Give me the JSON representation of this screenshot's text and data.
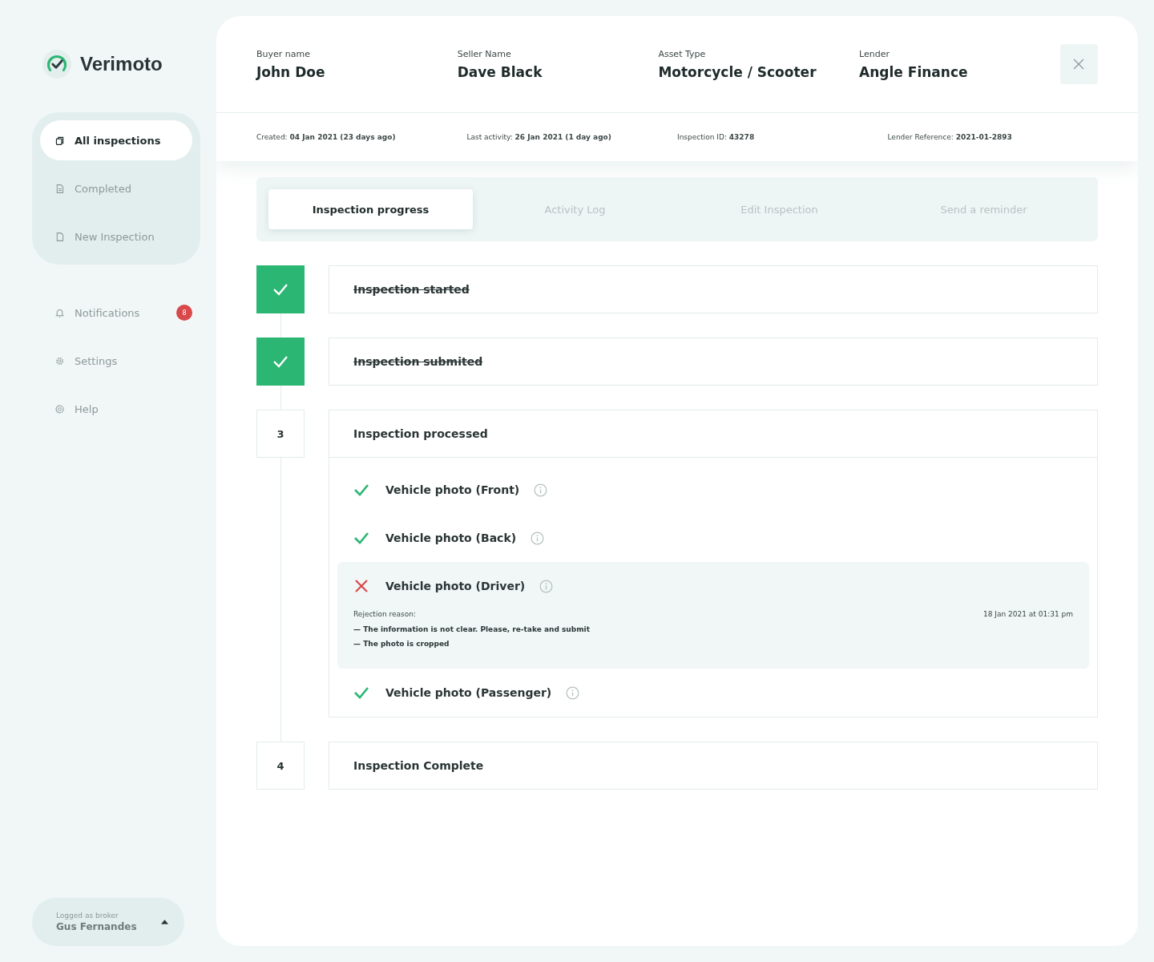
{
  "brand": {
    "name": "Verimoto"
  },
  "nav_primary": [
    {
      "label": "All inspections",
      "selected": true
    },
    {
      "label": "Completed",
      "selected": false
    },
    {
      "label": "New Inspection",
      "selected": false
    }
  ],
  "nav_secondary": [
    {
      "label": "Notifications",
      "badge": "8"
    },
    {
      "label": "Settings"
    },
    {
      "label": "Help"
    }
  ],
  "user": {
    "caption": "Logged as broker",
    "name": "Gus Fernandes"
  },
  "header": {
    "fields": [
      {
        "label": "Buyer name",
        "value": "John Doe"
      },
      {
        "label": "Seller Name",
        "value": "Dave Black"
      },
      {
        "label": "Asset Type",
        "value": "Motorcycle / Scooter"
      },
      {
        "label": "Lender",
        "value": "Angle Finance"
      }
    ],
    "meta": [
      "Created: **04 Jan 2021 (23 days ago)**",
      "Last activity: **26 Jan 2021 (1 day ago)**",
      "Inspection ID: **43278**",
      "Lender Reference: **2021-01-2893**"
    ]
  },
  "tabs": [
    {
      "label": "Inspection progress",
      "selected": true
    },
    {
      "label": "Activity Log",
      "selected": false
    },
    {
      "label": "Edit Inspection",
      "selected": false
    },
    {
      "label": "Send a reminder",
      "selected": false
    }
  ],
  "steps": [
    {
      "title": "Inspection started",
      "done": true
    },
    {
      "title": "Inspection submited",
      "done": true
    },
    {
      "number": "3",
      "title": "Inspection processed",
      "done": false,
      "checks": [
        {
          "label": "Vehicle photo (Front)",
          "kind": "passed"
        },
        {
          "label": "Vehicle photo (Back)",
          "kind": "passed"
        },
        {
          "label": "Vehicle photo (Driver)",
          "kind": "rejected",
          "rejection": {
            "caption": "Rejection reason:",
            "date": "18 Jan 2021 at 01:31 pm",
            "reasons": [
              "— The information is not clear. Please, re-take and submit",
              "— The photo is cropped"
            ]
          }
        },
        {
          "label": "Vehicle photo (Passenger)",
          "kind": "passed"
        }
      ]
    },
    {
      "number": "4",
      "title": "Inspection Complete",
      "done": false
    }
  ]
}
